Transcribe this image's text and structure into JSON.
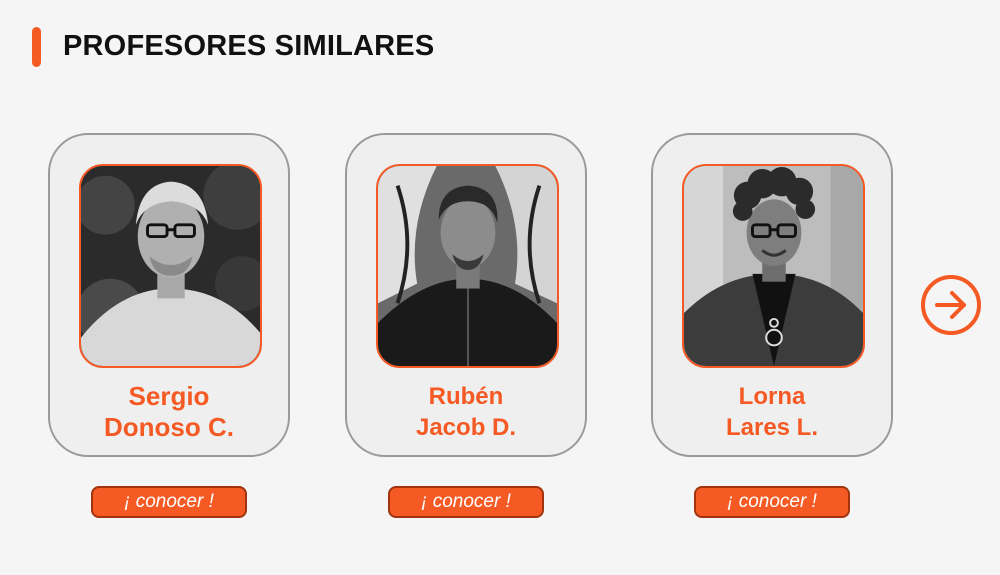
{
  "section": {
    "title": "PROFESORES SIMILARES"
  },
  "professors": [
    {
      "first": "Sergio",
      "last": "Donoso C.",
      "cta": "¡ conocer !"
    },
    {
      "first": "Rubén",
      "last": "Jacob D.",
      "cta": "¡ conocer !"
    },
    {
      "first": "Lorna",
      "last": "Lares L.",
      "cta": "¡ conocer !"
    }
  ],
  "carousel": {
    "next_icon": "arrow-right-circle-icon"
  },
  "colors": {
    "accent": "#f55a25",
    "card_bg": "#efefef",
    "card_border": "#9a9a9a",
    "title": "#111111"
  }
}
